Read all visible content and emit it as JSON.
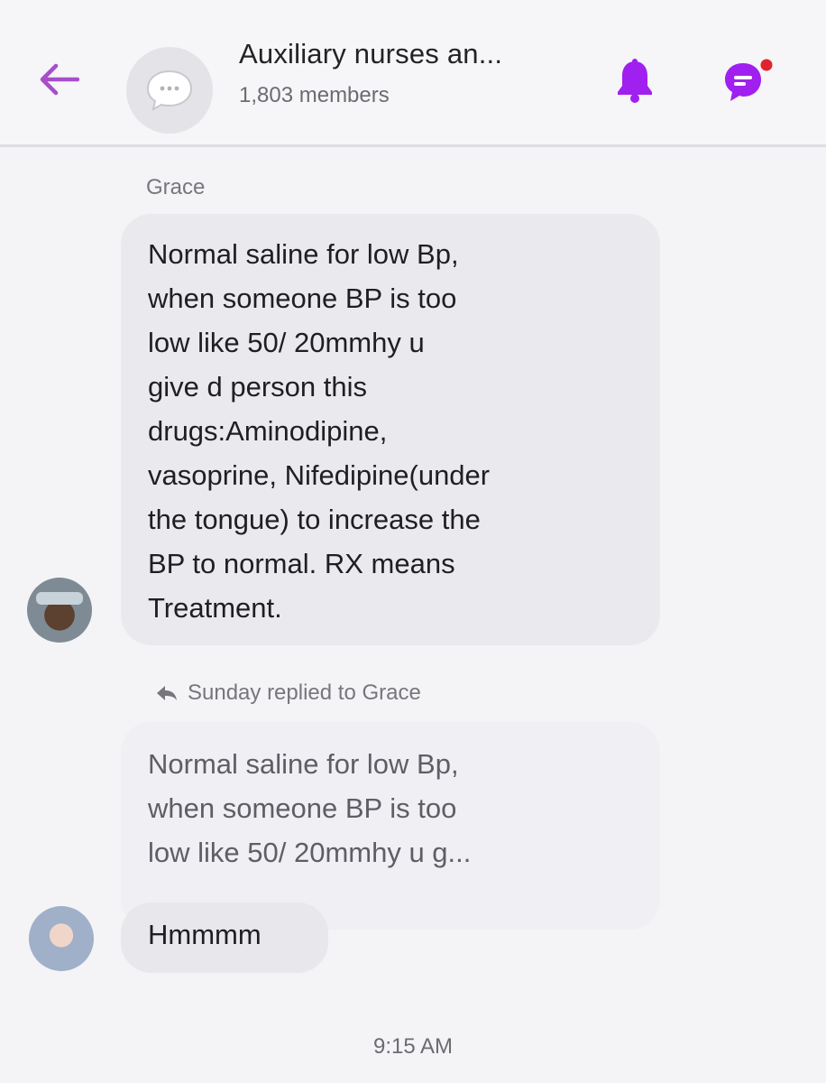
{
  "header": {
    "title": "Auxiliary nurses an...",
    "members": "1,803 members",
    "back_icon": "arrow-left-icon",
    "group_icon": "chat-bubble-icon",
    "bell_icon": "bell-icon",
    "chat_icon": "messenger-icon",
    "accent_color": "#a020f0",
    "notification_dot_color": "#e0242b"
  },
  "messages": [
    {
      "sender": "Grace",
      "text": "Normal saline for low Bp,\nwhen someone  BP is too\nlow like  50/ 20mmhy u\ngive d person this\ndrugs:Aminodipine,\nvasoprine, Nifedipine(under\nthe tongue) to increase the\nBP to normal. RX means\nTreatment."
    },
    {
      "reply_indicator": "Sunday replied to Grace",
      "quoted_text": "Normal saline for low Bp,\nwhen someone  BP is too\nlow like  50/ 20mmhy u  g...",
      "text": "Hmmmm"
    }
  ],
  "timestamp": "9:15 AM"
}
